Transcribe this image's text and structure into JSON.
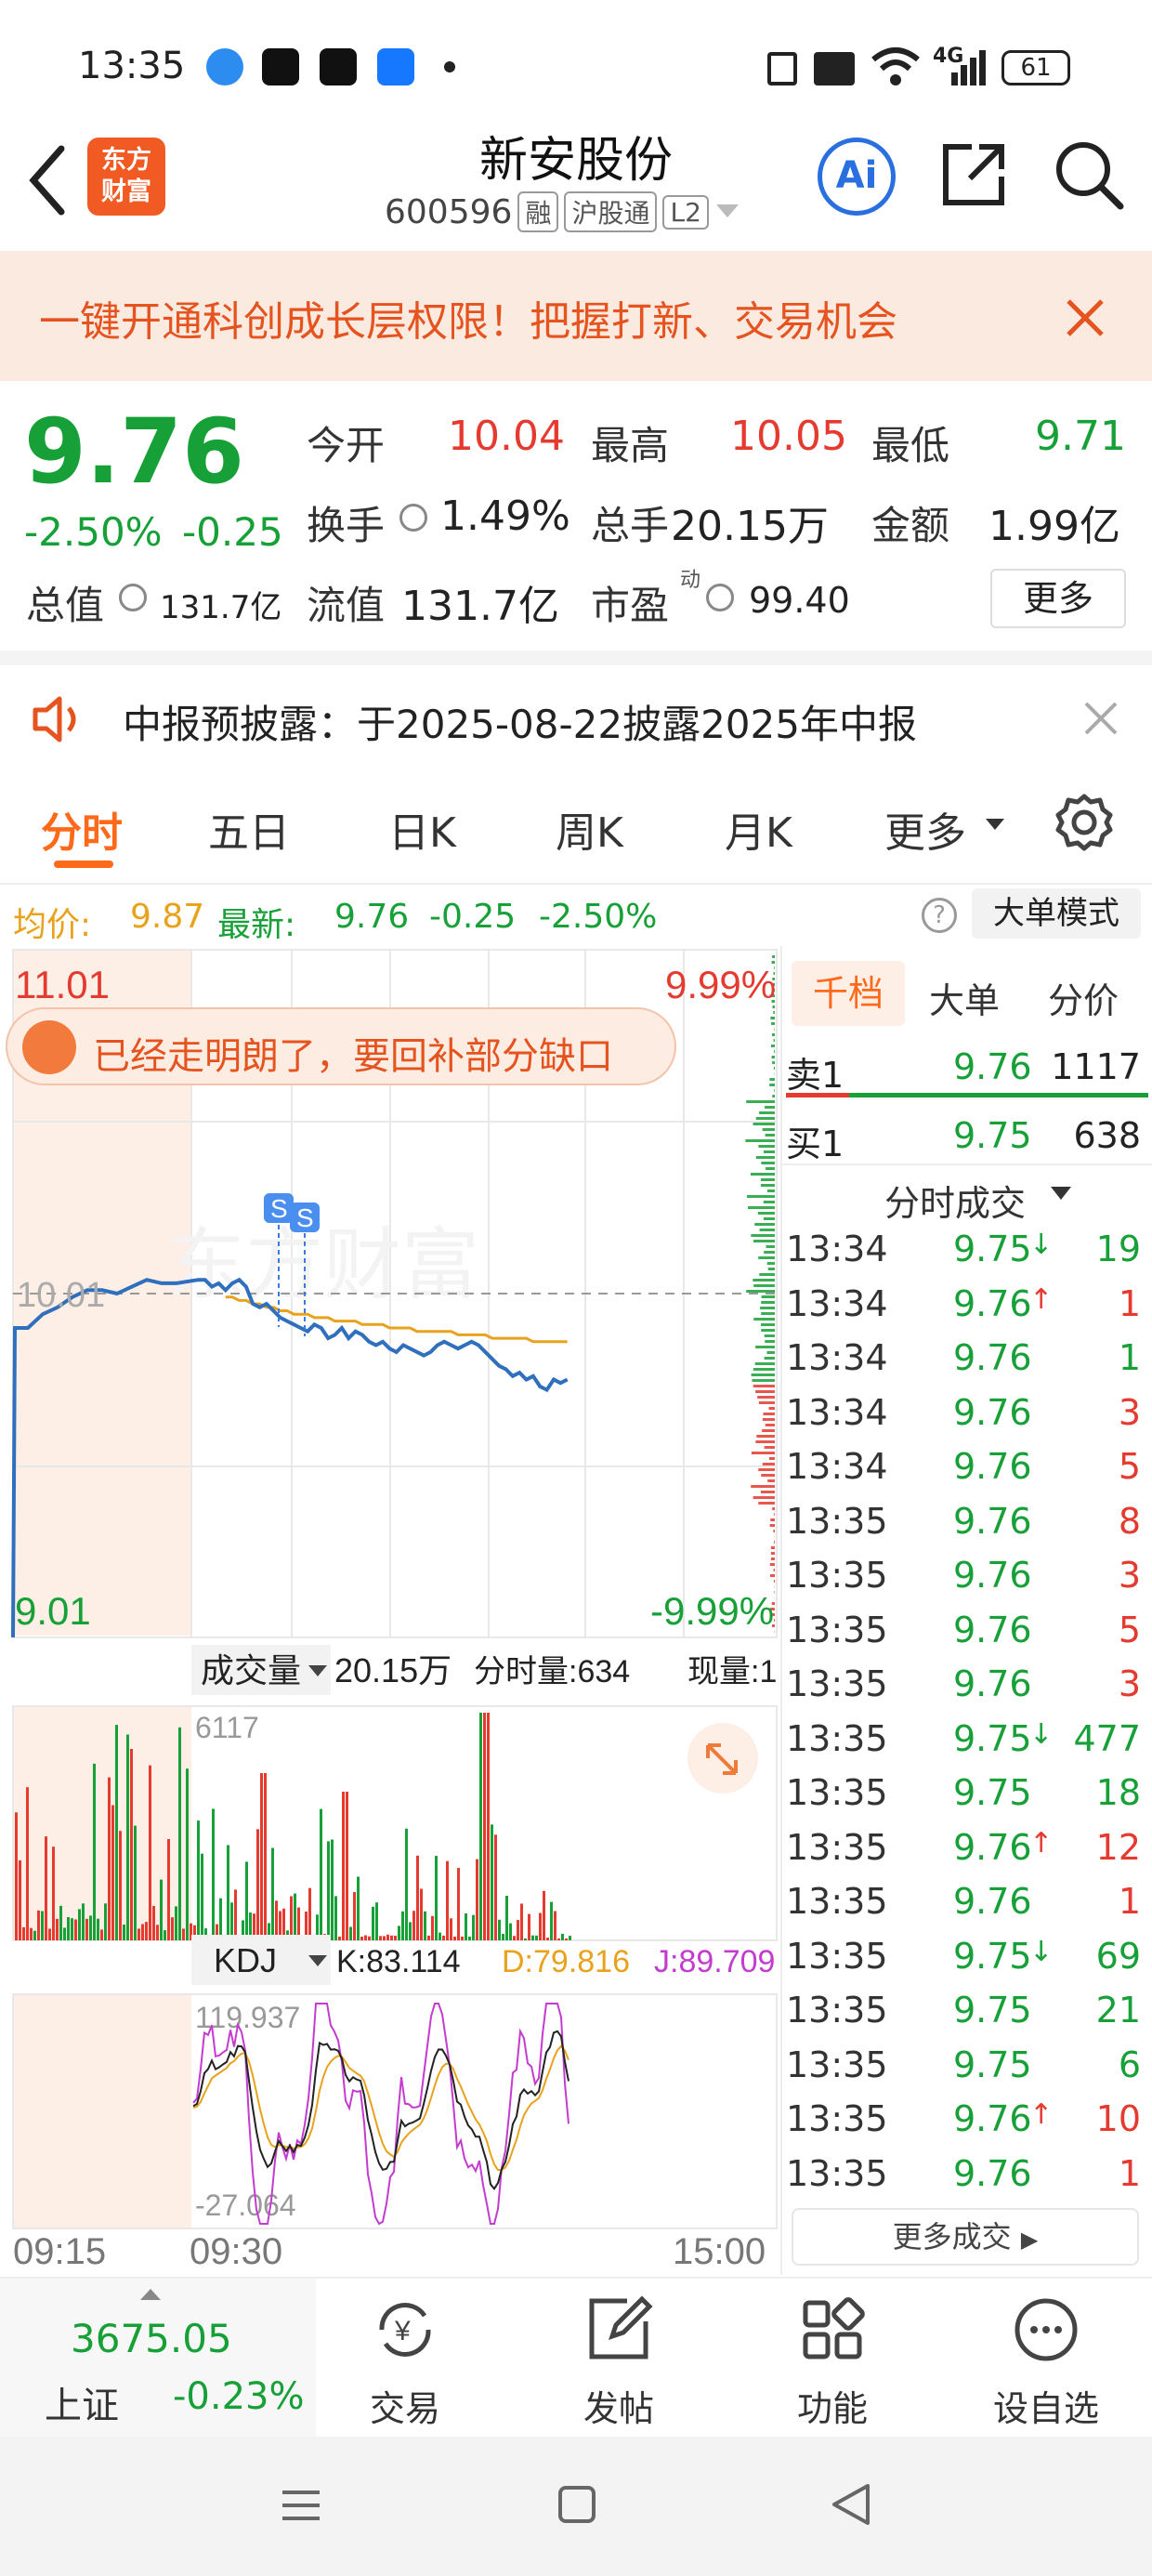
{
  "status_bar": {
    "time": "13:35",
    "battery": "61",
    "signal": "4G"
  },
  "header": {
    "back_icon": "chevron-left-icon",
    "logo_text": "东方\n财富",
    "title": "新安股份",
    "code": "600596",
    "tags": [
      "融",
      "沪股通",
      "L2"
    ],
    "ai_label": "Ai"
  },
  "banner": {
    "text": "一键开通科创成长层权限！把握打新、交易机会"
  },
  "quote": {
    "price": "9.76",
    "change_pct": "-2.50%",
    "change": "-0.25",
    "open_label": "今开",
    "open": "10.04",
    "high_label": "最高",
    "high": "10.05",
    "low_label": "最低",
    "low": "9.71",
    "turnover_label": "换手",
    "turnover": "1.49%",
    "volume_label": "总手",
    "volume": "20.15万",
    "amount_label": "金额",
    "amount": "1.99亿",
    "mktcap_label": "总值",
    "mktcap": "131.7亿",
    "float_label": "流值",
    "float": "131.7亿",
    "pe_label": "市盈",
    "pe_sup": "动",
    "pe": "99.40",
    "more_label": "更多"
  },
  "notice": {
    "text": "中报预披露：于2025-08-22披露2025年中报"
  },
  "tabs": [
    "分时",
    "五日",
    "日K",
    "周K",
    "月K",
    "更多"
  ],
  "chart_info": {
    "avg_label": "均价:",
    "avg": "9.87",
    "latest_label": "最新:",
    "latest": "9.76",
    "latest_chg": "-0.25",
    "latest_pct": "-2.50%",
    "big_order_mode": "大单模式"
  },
  "chart_data": {
    "type": "line",
    "y_top": "11.01",
    "y_bottom": "9.01",
    "pct_top": "9.99%",
    "pct_bottom": "-9.99%",
    "ref_price": "10.01",
    "ylim": [
      9.01,
      11.01
    ],
    "x_labels": [
      "09:15",
      "09:30",
      "15:00"
    ],
    "series": [
      {
        "name": "最新",
        "values": [
          9.01,
          9.91,
          9.95,
          9.97,
          10.0,
          10.02,
          10.02,
          10.01,
          10.03,
          10.05,
          10.04,
          10.04,
          10.05,
          10.05,
          10.03,
          10.04,
          10.02,
          10.04,
          10.05,
          10.03,
          9.98,
          9.97,
          9.98,
          9.96,
          9.94,
          9.93,
          9.92,
          9.91,
          9.9,
          9.92,
          9.91,
          9.88,
          9.89,
          9.91,
          9.88,
          9.9,
          9.89,
          9.87,
          9.86,
          9.87,
          9.85,
          9.84,
          9.86,
          9.85,
          9.84,
          9.83,
          9.84,
          9.86,
          9.87,
          9.86,
          9.85,
          9.86,
          9.87,
          9.86,
          9.84,
          9.82,
          9.8,
          9.79,
          9.77,
          9.78,
          9.76,
          9.77,
          9.74,
          9.73,
          9.76,
          9.75,
          9.76
        ]
      },
      {
        "name": "均价",
        "values": [
          null,
          null,
          null,
          null,
          null,
          null,
          null,
          null,
          null,
          null,
          null,
          null,
          null,
          null,
          null,
          null,
          10.0,
          10.0,
          9.99,
          9.99,
          9.98,
          9.98,
          9.97,
          9.97,
          9.96,
          9.96,
          9.95,
          9.95,
          9.95,
          9.94,
          9.94,
          9.94,
          9.93,
          9.93,
          9.93,
          9.93,
          9.92,
          9.92,
          9.92,
          9.92,
          9.91,
          9.91,
          9.91,
          9.91,
          9.9,
          9.9,
          9.9,
          9.9,
          9.9,
          9.9,
          9.89,
          9.89,
          9.89,
          9.89,
          9.89,
          9.88,
          9.88,
          9.88,
          9.88,
          9.88,
          9.88,
          9.87,
          9.87,
          9.87,
          9.87,
          9.87,
          9.87
        ]
      }
    ],
    "volume_label": "成交量",
    "volume_total": "20.15万",
    "volume_tick_label": "分时量:634",
    "volume_now_label": "现量:1",
    "volume_max": "6117",
    "kdj_label": "KDJ",
    "k": "K:83.114",
    "d": "D:79.816",
    "j": "J:89.709",
    "kdj_max": "119.937",
    "kdj_min": "-27.064",
    "signal_markers": [
      "S",
      "S"
    ],
    "tip": "已经走明朗了，要回补部分缺口"
  },
  "order_book": {
    "tabs": [
      "千档",
      "大单",
      "分价"
    ],
    "sell1": {
      "label": "卖1",
      "price": "9.76",
      "vol": "1117"
    },
    "buy1": {
      "label": "买1",
      "price": "9.75",
      "vol": "638"
    },
    "trades_header": "分时成交",
    "trades": [
      {
        "t": "13:34",
        "p": "9.75",
        "a": "down",
        "v": "19",
        "c": "g"
      },
      {
        "t": "13:34",
        "p": "9.76",
        "a": "up",
        "v": "1",
        "c": "r"
      },
      {
        "t": "13:34",
        "p": "9.76",
        "a": "",
        "v": "1",
        "c": "g"
      },
      {
        "t": "13:34",
        "p": "9.76",
        "a": "",
        "v": "3",
        "c": "r"
      },
      {
        "t": "13:34",
        "p": "9.76",
        "a": "",
        "v": "5",
        "c": "r"
      },
      {
        "t": "13:35",
        "p": "9.76",
        "a": "",
        "v": "8",
        "c": "r"
      },
      {
        "t": "13:35",
        "p": "9.76",
        "a": "",
        "v": "3",
        "c": "r"
      },
      {
        "t": "13:35",
        "p": "9.76",
        "a": "",
        "v": "5",
        "c": "r"
      },
      {
        "t": "13:35",
        "p": "9.76",
        "a": "",
        "v": "3",
        "c": "r"
      },
      {
        "t": "13:35",
        "p": "9.75",
        "a": "down",
        "v": "477",
        "c": "g"
      },
      {
        "t": "13:35",
        "p": "9.75",
        "a": "",
        "v": "18",
        "c": "g"
      },
      {
        "t": "13:35",
        "p": "9.76",
        "a": "up",
        "v": "12",
        "c": "r"
      },
      {
        "t": "13:35",
        "p": "9.76",
        "a": "",
        "v": "1",
        "c": "r"
      },
      {
        "t": "13:35",
        "p": "9.75",
        "a": "down",
        "v": "69",
        "c": "g"
      },
      {
        "t": "13:35",
        "p": "9.75",
        "a": "",
        "v": "21",
        "c": "g"
      },
      {
        "t": "13:35",
        "p": "9.75",
        "a": "",
        "v": "6",
        "c": "g"
      },
      {
        "t": "13:35",
        "p": "9.76",
        "a": "up",
        "v": "10",
        "c": "r"
      },
      {
        "t": "13:35",
        "p": "9.76",
        "a": "",
        "v": "1",
        "c": "r"
      }
    ],
    "more_trades": "更多成交"
  },
  "bottom_nav": {
    "index_value": "3675.05",
    "index_name": "上证",
    "index_chg": "-0.23%",
    "items": [
      "交易",
      "发帖",
      "功能",
      "设自选"
    ]
  },
  "colors": {
    "up": "#e43a2f",
    "down": "#16a037",
    "avg": "#e8a21c",
    "line": "#2f6fbd",
    "accent": "#ff6a1a"
  }
}
